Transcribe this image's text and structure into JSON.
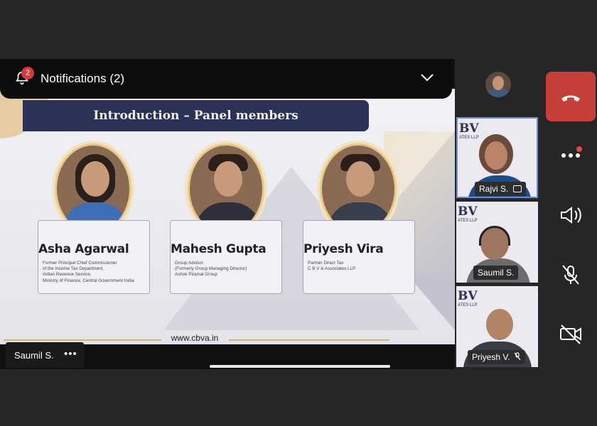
{
  "notifications": {
    "label": "Notifications (2)",
    "count": "2"
  },
  "slide": {
    "title": "Introduction – Panel members",
    "website": "www.cbva.in",
    "panelists": [
      {
        "name": "Asha Agarwal",
        "lines": [
          "Former Principal Chief Commissioner",
          "of the Income Tax Department,",
          "Indian Revenue Service,",
          "Ministry of Finance, Central Government India"
        ]
      },
      {
        "name": "Mahesh Gupta",
        "lines": [
          "Group Advisor",
          "(Formerly Group Managing Director)",
          "Ashok Piramal Group"
        ]
      },
      {
        "name": "Priyesh Vira",
        "lines": [
          "Partner Direct Tax",
          "C B V & Associates LLP"
        ]
      }
    ]
  },
  "presenter": {
    "name": "Saumil S.",
    "more": "•••"
  },
  "participants": [
    {
      "name": "Rajvi S.",
      "logo": "BV",
      "logo_sub": "ATES LLP",
      "icon": "screen-share-icon",
      "active": true
    },
    {
      "name": "Saumil S.",
      "logo": "BV",
      "logo_sub": "ATES LLP",
      "icon": "",
      "active": false
    },
    {
      "name": "Priyesh V.",
      "logo": "BV",
      "logo_sub": "ATES LLP",
      "icon": "mic-muted-icon",
      "active": false
    }
  ],
  "controls": [
    "hang-up-icon",
    "more-icon",
    "speaker-icon",
    "mic-muted-icon",
    "camera-off-icon"
  ],
  "colors": {
    "hangup": "#c53f3a",
    "slide_navy": "#2b3157",
    "gold": "#e7c98c",
    "active_border": "#6f8cd6"
  }
}
